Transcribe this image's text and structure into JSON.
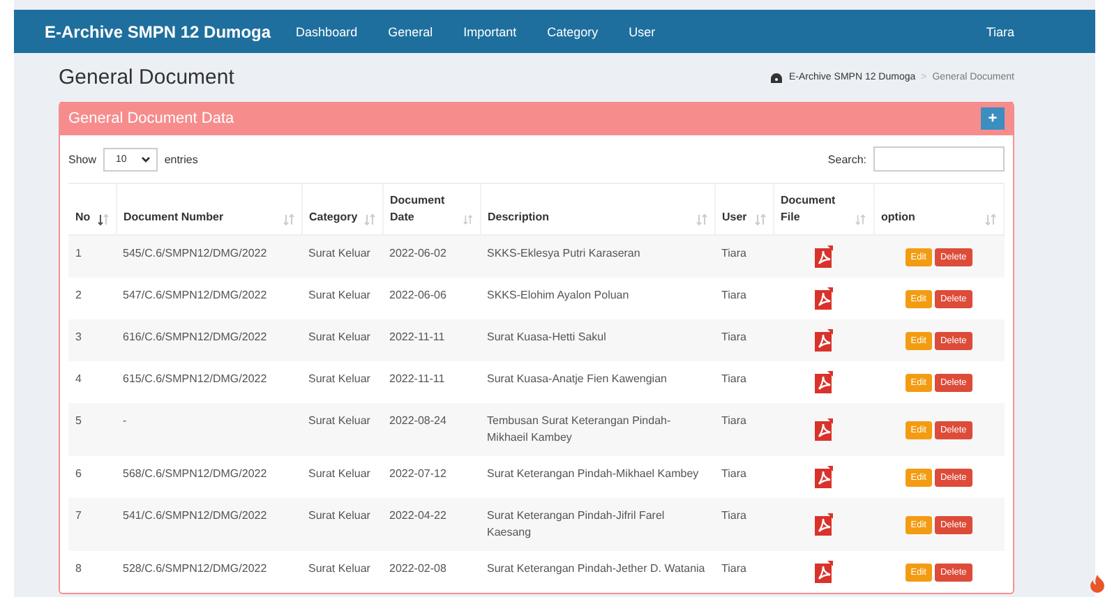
{
  "navbar": {
    "brand": "E-Archive SMPN 12 Dumoga",
    "menu": [
      "Dashboard",
      "General",
      "Important",
      "Category",
      "User"
    ],
    "user": "Tiara"
  },
  "page": {
    "title": "General Document",
    "breadcrumb": [
      "E-Archive SMPN 12 Dumoga",
      "General Document"
    ],
    "breadcrumb_separator": ">"
  },
  "card": {
    "title": "General Document Data",
    "add_button": "+"
  },
  "controls": {
    "show_label": "Show",
    "page_size": "10",
    "entries_label": "entries",
    "search_label": "Search:"
  },
  "table": {
    "columns": [
      {
        "label": "No",
        "sorted": true
      },
      {
        "label": "Document Number",
        "sorted": false
      },
      {
        "label": "Category",
        "sorted": false
      },
      {
        "label": "Document Date",
        "sorted": false
      },
      {
        "label": "Description",
        "sorted": false
      },
      {
        "label": "User",
        "sorted": false
      },
      {
        "label": "Document File",
        "sorted": false
      },
      {
        "label": "option",
        "sorted": false
      }
    ],
    "rows": [
      {
        "no": "1",
        "number": "545/C.6/SMPN12/DMG/2022",
        "category": "Surat Keluar",
        "date": "2022-06-02",
        "description": "SKKS-Eklesya Putri Karaseran",
        "user": "Tiara",
        "edit": "Edit",
        "delete": "Delete"
      },
      {
        "no": "2",
        "number": "547/C.6/SMPN12/DMG/2022",
        "category": "Surat Keluar",
        "date": "2022-06-06",
        "description": "SKKS-Elohim Ayalon Poluan",
        "user": "Tiara",
        "edit": "Edit",
        "delete": "Delete"
      },
      {
        "no": "3",
        "number": "616/C.6/SMPN12/DMG/2022",
        "category": "Surat Keluar",
        "date": "2022-11-11",
        "description": "Surat Kuasa-Hetti Sakul",
        "user": "Tiara",
        "edit": "Edit",
        "delete": "Delete"
      },
      {
        "no": "4",
        "number": "615/C.6/SMPN12/DMG/2022",
        "category": "Surat Keluar",
        "date": "2022-11-11",
        "description": "Surat Kuasa-Anatje Fien Kawengian",
        "user": "Tiara",
        "edit": "Edit",
        "delete": "Delete"
      },
      {
        "no": "5",
        "number": "-",
        "category": "Surat Keluar",
        "date": "2022-08-24",
        "description": "Tembusan Surat Keterangan Pindah-Mikhaeil Kambey",
        "user": "Tiara",
        "edit": "Edit",
        "delete": "Delete"
      },
      {
        "no": "6",
        "number": "568/C.6/SMPN12/DMG/2022",
        "category": "Surat Keluar",
        "date": "2022-07-12",
        "description": "Surat Keterangan Pindah-Mikhael Kambey",
        "user": "Tiara",
        "edit": "Edit",
        "delete": "Delete"
      },
      {
        "no": "7",
        "number": "541/C.6/SMPN12/DMG/2022",
        "category": "Surat Keluar",
        "date": "2022-04-22",
        "description": "Surat Keterangan Pindah-Jifril Farel Kaesang",
        "user": "Tiara",
        "edit": "Edit",
        "delete": "Delete"
      },
      {
        "no": "8",
        "number": "528/C.6/SMPN12/DMG/2022",
        "category": "Surat Keluar",
        "date": "2022-02-08",
        "description": "Surat Keterangan Pindah-Jether D. Watania",
        "user": "Tiara",
        "edit": "Edit",
        "delete": "Delete"
      }
    ]
  }
}
